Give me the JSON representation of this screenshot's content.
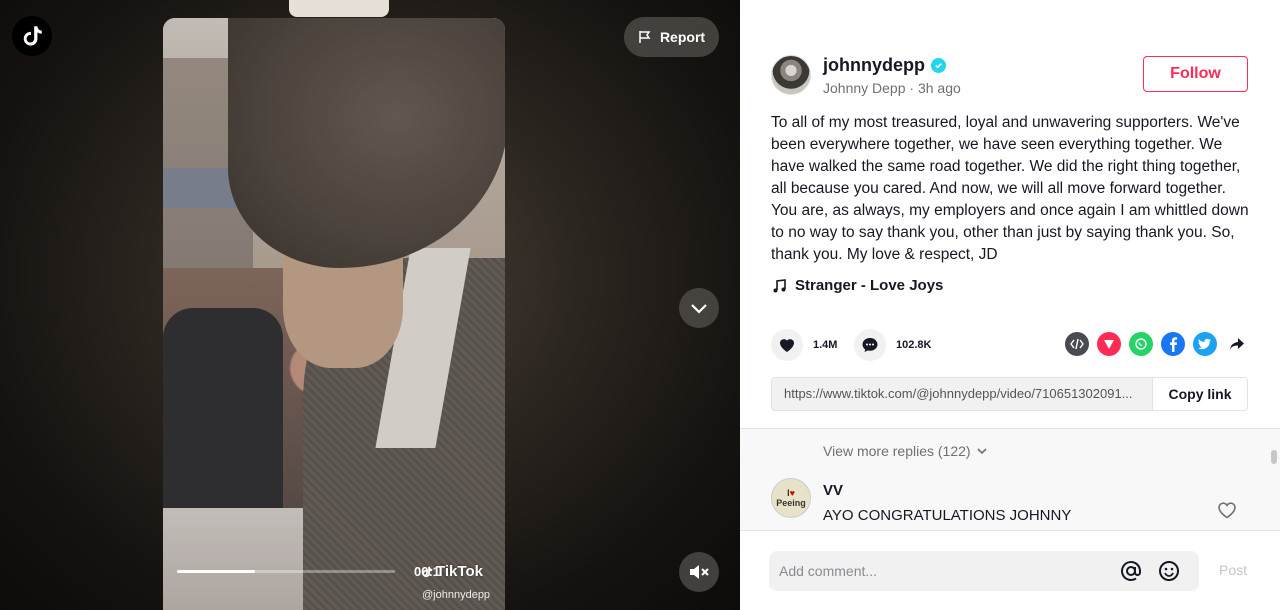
{
  "video": {
    "report_label": "Report",
    "time": "00:1",
    "watermark": "TikTok",
    "watermark_user": "@johnnydepp",
    "progress": 0.36
  },
  "post": {
    "username": "johnnydepp",
    "display_name_time": "Johnny Depp · 3h ago",
    "follow_label": "Follow",
    "caption": "To all of my most treasured, loyal and unwavering supporters. We've been everywhere together, we have seen everything together. We have walked the same road together. We did the right thing together, all because you cared. And now, we will all move forward together. You are, as always, my employers and once again I am whittled down to no way to say thank you, other than just by saying thank you. So, thank you. My love & respect, JD",
    "music": "Stranger - Love Joys",
    "likes": "1.4M",
    "comments": "102.8K",
    "link": "https://www.tiktok.com/@johnnydepp/video/710651302091...",
    "copy_label": "Copy link"
  },
  "comments": {
    "view_more": "View more replies (122)",
    "items": [
      {
        "avatar_line1": "I",
        "avatar_line2": "Peeing",
        "name": "VV",
        "text": "AYO CONGRATULATIONS JOHNNY"
      }
    ],
    "input_placeholder": "Add comment...",
    "post_label": "Post"
  },
  "colors": {
    "accent": "#fe2c55",
    "verified": "#20d5ec",
    "embed": "#4a4a52",
    "direct": "#fe2c55",
    "whatsapp": "#25d366",
    "facebook": "#1877f2",
    "twitter": "#1da1f2"
  },
  "icons": [
    "tiktok-logo-icon",
    "flag-icon",
    "chevron-down-icon",
    "mute-icon",
    "verified-icon",
    "music-note-icon",
    "heart-icon",
    "comment-icon",
    "embed-icon",
    "send-icon",
    "whatsapp-icon",
    "facebook-icon",
    "twitter-icon",
    "share-arrow-icon",
    "at-icon",
    "emoji-icon"
  ]
}
